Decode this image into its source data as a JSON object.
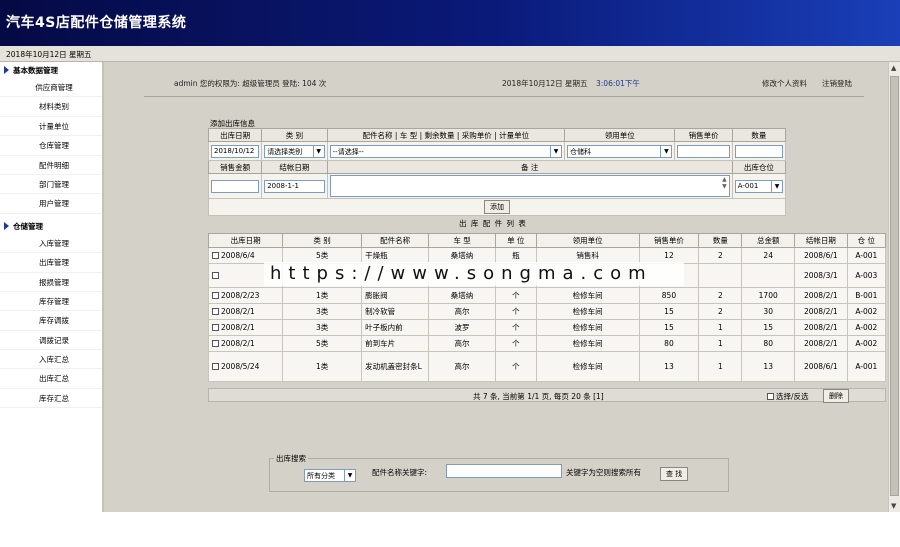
{
  "header": {
    "title": "汽车4S店配件仓储管理系统"
  },
  "datebar": {
    "date": "2018年10月12日 星期五"
  },
  "sidebar": {
    "sections": [
      {
        "label": "基本数据管理",
        "items": [
          "供应商管理",
          "材料类别",
          "计量单位",
          "仓库管理",
          "配件明细",
          "部门管理",
          "用户管理"
        ]
      },
      {
        "label": "仓储管理",
        "items": [
          "入库管理",
          "出库管理",
          "报损管理",
          "库存管理",
          "库存调拨",
          "调拨记录",
          "入库汇总",
          "出库汇总",
          "库存汇总"
        ]
      }
    ]
  },
  "topinfo": {
    "user": "admin 您的权限为: 超级管理员 登陆: 104 次",
    "date": "2018年10月12日 星期五",
    "time": "3:06:01下午",
    "edit_profile": "修改个人资料",
    "logout": "注销登陆"
  },
  "form": {
    "section_title": "添加出库信息",
    "headers_row1": [
      "出库日期",
      "类 别",
      "配件名称 | 车 型 | 剩余数量 | 采购单价 | 计量单位",
      "领用单位",
      "销售单价",
      "数量"
    ],
    "date_value": "2018/10/12",
    "category_value": "请选择类别",
    "part_value": "--请选择--",
    "dept_value": "仓储科",
    "headers_row2": [
      "销售金额",
      "结帐日期",
      "备 注",
      "出库仓位"
    ],
    "settle_value": "2008-1-1",
    "location_value": "A-001",
    "add_button": "添加"
  },
  "list": {
    "title": "出 库 配 件 列 表",
    "columns": [
      "出库日期",
      "类 别",
      "配件名称",
      "车 型",
      "单 位",
      "领用单位",
      "销售单价",
      "数量",
      "总金额",
      "结帐日期",
      "仓 位"
    ],
    "rows": [
      [
        "2008/6/4",
        "5类",
        "干燥瓶",
        "桑塔纳",
        "瓶",
        "销售科",
        "12",
        "2",
        "24",
        "2008/6/1",
        "A-001"
      ],
      [
        "",
        "",
        "",
        "",
        "",
        "",
        "",
        "",
        "",
        "2008/3/1",
        "A-003"
      ],
      [
        "2008/2/23",
        "1类",
        "膨胀阀",
        "桑塔纳",
        "个",
        "检修车间",
        "850",
        "2",
        "1700",
        "2008/2/1",
        "B-001"
      ],
      [
        "2008/2/1",
        "3类",
        "制冷软管",
        "高尔",
        "个",
        "检修车间",
        "15",
        "2",
        "30",
        "2008/2/1",
        "A-002"
      ],
      [
        "2008/2/1",
        "3类",
        "叶子板内前",
        "波罗",
        "个",
        "检修车间",
        "15",
        "1",
        "15",
        "2008/2/1",
        "A-002"
      ],
      [
        "2008/2/1",
        "5类",
        "前到车片",
        "高尔",
        "个",
        "检修车间",
        "80",
        "1",
        "80",
        "2008/2/1",
        "A-002"
      ],
      [
        "2008/5/24",
        "1类",
        "发动机盖密封条L",
        "高尔",
        "个",
        "检修车间",
        "13",
        "1",
        "13",
        "2008/6/1",
        "A-001"
      ]
    ],
    "footer_text": "共 7 条, 当前第 1/1 页, 每页 20 条 [1]",
    "select_label": "选择/反选",
    "delete_button": "删除"
  },
  "watermark": "https://www.songma.com",
  "search": {
    "legend": "出库搜索",
    "category_value": "所有分类",
    "keyword_label": "配件名称关键字:",
    "hint": "关键字为空则搜索所有",
    "search_button": "查 找"
  }
}
